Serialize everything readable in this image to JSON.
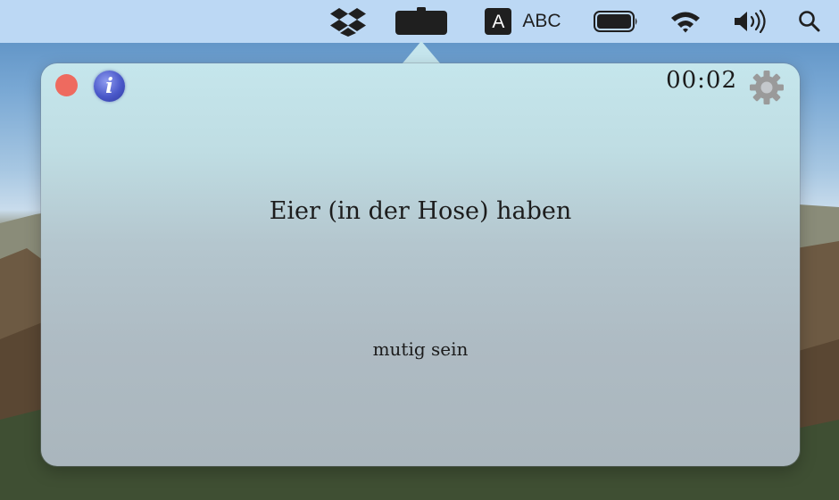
{
  "menubar": {
    "input_source_letter": "A",
    "input_source_label": "ABC",
    "icons": [
      "dropbox-icon",
      "app-menubar-icon",
      "battery-icon",
      "wifi-icon",
      "volume-icon",
      "search-icon"
    ],
    "background_color": "#bcd8f4"
  },
  "popup": {
    "timer": "00:02",
    "phrase": "Eier (in der Hose) haben",
    "meaning": "mutig sein",
    "info_icon_letter": "i",
    "colors": {
      "close_button": "#ee6a5f",
      "info_button": "#4a58c9",
      "gear": "#9a9a9a"
    }
  }
}
